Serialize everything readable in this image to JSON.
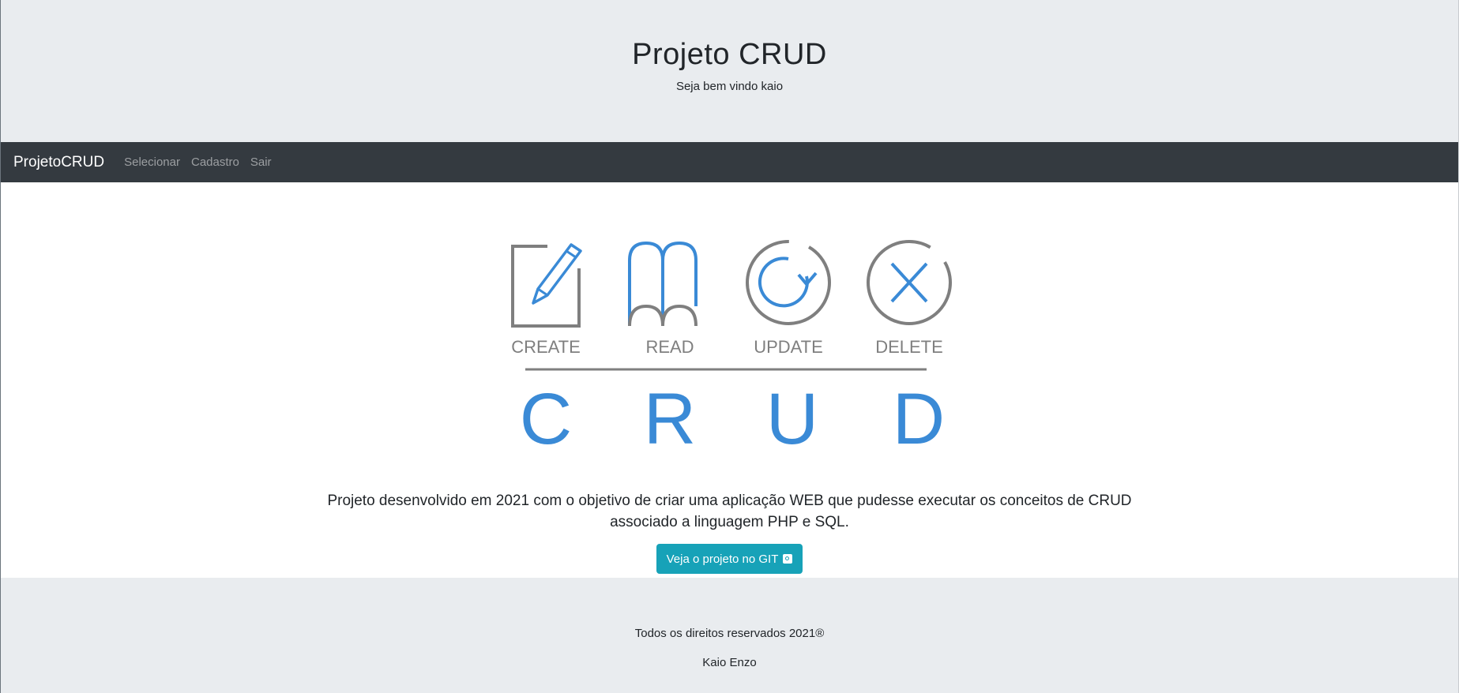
{
  "header": {
    "title": "Projeto CRUD",
    "subtitle": "Seja bem vindo kaio"
  },
  "navbar": {
    "brand": "ProjetoCRUD",
    "links": [
      "Selecionar",
      "Cadastro",
      "Sair"
    ]
  },
  "logo": {
    "labels": [
      "CREATE",
      "READ",
      "UPDATE",
      "DELETE"
    ],
    "letters": [
      "C",
      "R",
      "U",
      "D"
    ],
    "colors": {
      "gray": "#7f7f7f",
      "blue": "#3a8ad6"
    }
  },
  "main": {
    "description_line1": "Projeto desenvolvido em 2021 com o objetivo de criar uma aplicação WEB que pudesse executar os conceitos de CRUD",
    "description_line2": "associado a linguagem PHP e SQL.",
    "git_button": "Veja o projeto no GIT",
    "git_icon": "github-icon"
  },
  "footer": {
    "copyright": "Todos os direitos reservados 2021®",
    "author": "Kaio Enzo"
  },
  "colors": {
    "navbar_bg": "#343a40",
    "jumbotron_bg": "#e9ecef",
    "button_bg": "#17a2b8"
  }
}
